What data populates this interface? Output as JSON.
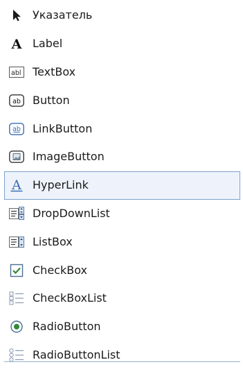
{
  "toolbox": {
    "selected_index": 6,
    "colors": {
      "selected_background": "#eef3fb",
      "selected_border": "#7da2ce",
      "icon_blue": "#3a6db5",
      "icon_green": "#2f8a3a"
    },
    "items": [
      {
        "label": "Указатель",
        "icon": "pointer-icon"
      },
      {
        "label": "Label",
        "icon": "label-icon"
      },
      {
        "label": "TextBox",
        "icon": "textbox-icon"
      },
      {
        "label": "Button",
        "icon": "button-icon"
      },
      {
        "label": "LinkButton",
        "icon": "linkbutton-icon"
      },
      {
        "label": "ImageButton",
        "icon": "imagebutton-icon"
      },
      {
        "label": "HyperLink",
        "icon": "hyperlink-icon"
      },
      {
        "label": "DropDownList",
        "icon": "dropdownlist-icon"
      },
      {
        "label": "ListBox",
        "icon": "listbox-icon"
      },
      {
        "label": "CheckBox",
        "icon": "checkbox-icon"
      },
      {
        "label": "CheckBoxList",
        "icon": "checkboxlist-icon"
      },
      {
        "label": "RadioButton",
        "icon": "radiobutton-icon"
      },
      {
        "label": "RadioButtonList",
        "icon": "radiobuttonlist-icon"
      }
    ]
  }
}
